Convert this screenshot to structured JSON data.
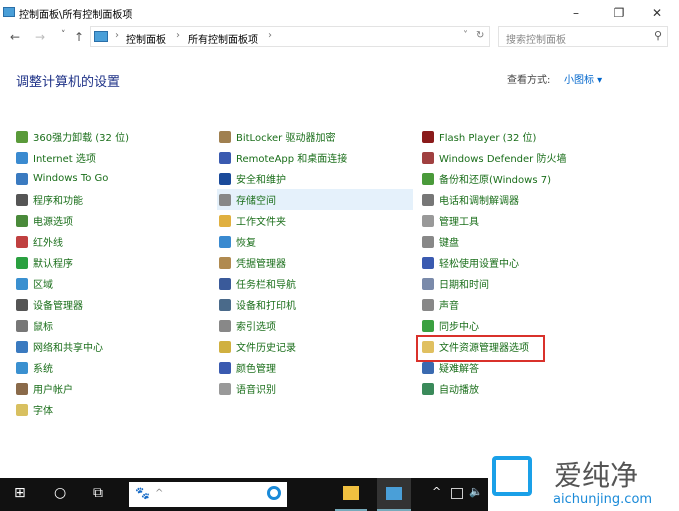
{
  "window": {
    "title": "控制面板\\所有控制面板项",
    "minimize": "–",
    "maximize": "❐",
    "close": "✕"
  },
  "nav": {
    "back": "←",
    "forward": "→",
    "recent": "˅",
    "up": "↑",
    "crumbs": [
      "控制面板",
      "所有控制面板项"
    ],
    "sep": "›",
    "dropdown": "˅",
    "refresh": "↻"
  },
  "search": {
    "placeholder": "搜索控制面板",
    "icon": "⚲"
  },
  "heading": "调整计算机的设置",
  "view": {
    "label": "查看方式:",
    "value": "小图标 ▾"
  },
  "columns": [
    [
      {
        "label": "360强力卸载 (32 位)",
        "color": "#5a9a3a"
      },
      {
        "label": "Internet 选项",
        "color": "#3a8ad0"
      },
      {
        "label": "Windows To Go",
        "color": "#3a7ac0"
      },
      {
        "label": "程序和功能",
        "color": "#555555"
      },
      {
        "label": "电源选项",
        "color": "#4a8a3a"
      },
      {
        "label": "红外线",
        "color": "#c04040"
      },
      {
        "label": "默认程序",
        "color": "#2aa040"
      },
      {
        "label": "区域",
        "color": "#3a90d0"
      },
      {
        "label": "设备管理器",
        "color": "#555555"
      },
      {
        "label": "鼠标",
        "color": "#777777"
      },
      {
        "label": "网络和共享中心",
        "color": "#3a7ac0"
      },
      {
        "label": "系统",
        "color": "#3a90d0"
      },
      {
        "label": "用户帐户",
        "color": "#8a6a4a"
      },
      {
        "label": "字体",
        "color": "#d8c060"
      }
    ],
    [
      {
        "label": "BitLocker 驱动器加密",
        "color": "#a08050"
      },
      {
        "label": "RemoteApp 和桌面连接",
        "color": "#3a5ab0"
      },
      {
        "label": "安全和维护",
        "color": "#1a4a9a"
      },
      {
        "label": "存储空间",
        "color": "#888888"
      },
      {
        "label": "工作文件夹",
        "color": "#e0b040"
      },
      {
        "label": "恢复",
        "color": "#3a8ad0"
      },
      {
        "label": "凭据管理器",
        "color": "#b08a50"
      },
      {
        "label": "任务栏和导航",
        "color": "#3a5a9a"
      },
      {
        "label": "设备和打印机",
        "color": "#4a6a8a"
      },
      {
        "label": "索引选项",
        "color": "#888888"
      },
      {
        "label": "文件历史记录",
        "color": "#d0b040"
      },
      {
        "label": "颜色管理",
        "color": "#3a5ab0"
      },
      {
        "label": "语音识别",
        "color": "#999999"
      }
    ],
    [
      {
        "label": "Flash Player (32 位)",
        "color": "#8a1a1a"
      },
      {
        "label": "Windows Defender 防火墙",
        "color": "#a04040"
      },
      {
        "label": "备份和还原(Windows 7)",
        "color": "#4a9a3a"
      },
      {
        "label": "电话和调制解调器",
        "color": "#777777"
      },
      {
        "label": "管理工具",
        "color": "#999999"
      },
      {
        "label": "键盘",
        "color": "#888888"
      },
      {
        "label": "轻松使用设置中心",
        "color": "#3a5ab0"
      },
      {
        "label": "日期和时间",
        "color": "#7a8aaa"
      },
      {
        "label": "声音",
        "color": "#888888"
      },
      {
        "label": "同步中心",
        "color": "#3aa040"
      },
      {
        "label": "文件资源管理器选项",
        "color": "#e0c060"
      },
      {
        "label": "疑难解答",
        "color": "#3a6ab0"
      },
      {
        "label": "自动播放",
        "color": "#3a8a5a"
      }
    ]
  ],
  "taskbar": {
    "start": "⊞",
    "cortana": "○",
    "taskview": "⧉",
    "search_icon": "🐾",
    "search_caret": "^",
    "tray_up": "^",
    "volume": "🔈"
  },
  "watermark": {
    "cn": "爱纯净",
    "en": "aichunjing.com"
  }
}
